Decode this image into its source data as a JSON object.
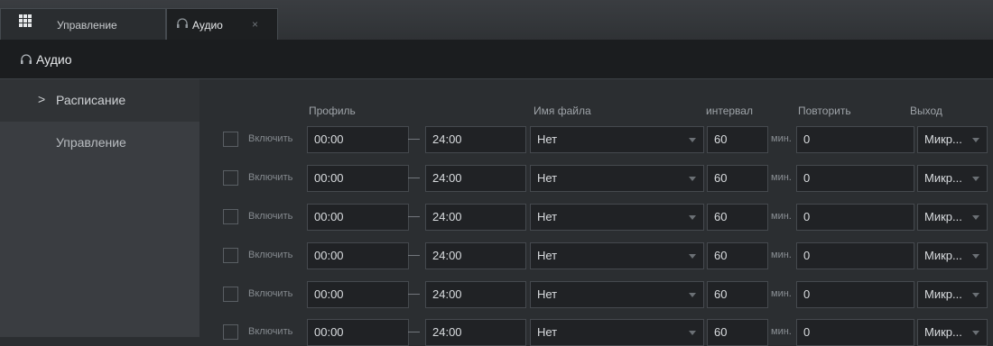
{
  "tabs": {
    "manage": {
      "label": "Управление",
      "icon": "grid-icon"
    },
    "audio": {
      "label": "Аудио",
      "icon": "headphones-icon",
      "close": "×"
    }
  },
  "header": {
    "title": "Аудио",
    "icon": "headphones-icon"
  },
  "sidebar": {
    "items": [
      {
        "label": "Расписание",
        "active": true,
        "chevron": ">"
      },
      {
        "label": "Управление",
        "active": false
      }
    ]
  },
  "table": {
    "columns": {
      "profile": "Профиль",
      "file": "Имя файла",
      "interval": "интервал",
      "repeat": "Повторить",
      "output": "Выход"
    },
    "enable_label": "Включить",
    "dash": "—",
    "unit": "мин.",
    "rows": [
      {
        "enabled": false,
        "start": "00:00",
        "end": "24:00",
        "file": "Нет",
        "interval": "60",
        "repeat": "0",
        "output": "Микр..."
      },
      {
        "enabled": false,
        "start": "00:00",
        "end": "24:00",
        "file": "Нет",
        "interval": "60",
        "repeat": "0",
        "output": "Микр..."
      },
      {
        "enabled": false,
        "start": "00:00",
        "end": "24:00",
        "file": "Нет",
        "interval": "60",
        "repeat": "0",
        "output": "Микр..."
      },
      {
        "enabled": false,
        "start": "00:00",
        "end": "24:00",
        "file": "Нет",
        "interval": "60",
        "repeat": "0",
        "output": "Микр..."
      },
      {
        "enabled": false,
        "start": "00:00",
        "end": "24:00",
        "file": "Нет",
        "interval": "60",
        "repeat": "0",
        "output": "Микр..."
      },
      {
        "enabled": false,
        "start": "00:00",
        "end": "24:00",
        "file": "Нет",
        "interval": "60",
        "repeat": "0",
        "output": "Микр..."
      }
    ]
  },
  "colors": {
    "accent": "#2b2e31",
    "sidebar": "#3a3d41",
    "field": "#202225"
  }
}
